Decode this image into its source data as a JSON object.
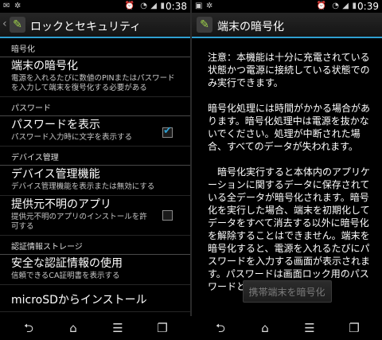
{
  "left": {
    "status": {
      "time": "0:38"
    },
    "title": "ロックとセキュリティ",
    "sections": [
      {
        "header": "暗号化",
        "items": [
          {
            "title": "端末の暗号化",
            "summary": "電源を入れるたびに数値のPINまたはパスワードを入力して端末を復号化する必要がある",
            "checkbox": null
          }
        ]
      },
      {
        "header": "パスワード",
        "items": [
          {
            "title": "パスワードを表示",
            "summary": "パスワード入力時に文字を表示する",
            "checkbox": true
          }
        ]
      },
      {
        "header": "デバイス管理",
        "items": [
          {
            "title": "デバイス管理機能",
            "summary": "デバイス管理機能を表示または無効にする",
            "checkbox": null
          },
          {
            "title": "提供元不明のアプリ",
            "summary": "提供元不明のアプリのインストールを許可する",
            "checkbox": false
          }
        ]
      },
      {
        "header": "認証情報ストレージ",
        "items": [
          {
            "title": "安全な認証情報の使用",
            "summary": "信頼できるCA証明書を表示する",
            "checkbox": null
          },
          {
            "title": "microSDからインストール",
            "summary": "",
            "checkbox": null
          }
        ]
      }
    ]
  },
  "right": {
    "status": {
      "time": "0:39"
    },
    "title": "端末の暗号化",
    "paragraphs": [
      "注意：本機能は十分に充電されている状態かつ電源に接続している状態でのみ実行できます。",
      "暗号化処理には時間がかかる場合があります。暗号化処理中は電源を抜かないでください。処理が中断された場合、すべてのデータが失われます。",
      "　暗号化実行すると本体内のアプリケーションに関するデータに保存されている全データが暗号化されます。暗号化を実行した場合、端末を初期化してデータをすべて消去する以外に暗号化を解除することはできません。端末を暗号化すると、電源を入れるたびにパスワードを入力する画面が表示されます。パスワードは画面ロック用のパスワードと同一"
    ],
    "button_label": "携帯端末を暗号化"
  },
  "nav_icons": [
    "back-icon",
    "home-icon",
    "menu-icon",
    "recent-apps-icon"
  ],
  "colors": {
    "accent": "#2f9fd0",
    "background": "#000000"
  }
}
